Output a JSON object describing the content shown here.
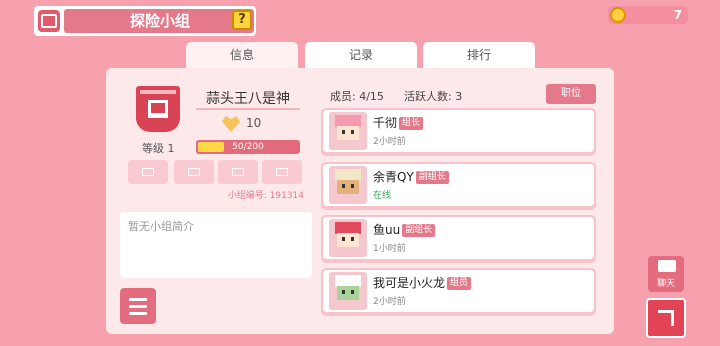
{
  "header": {
    "title": "探险小组",
    "help_label": "?",
    "currency_value": "7"
  },
  "tabs": [
    "信息",
    "记录",
    "排行"
  ],
  "group": {
    "name": "蒜头王八是神",
    "popularity": "10",
    "level_label": "等级 1",
    "exp_text": "50/200",
    "exp_fraction": 0.25,
    "id_label": "小组编号: 191314",
    "intro_text": "暂无小组简介"
  },
  "members_header": {
    "count_text": "成员: 4/15",
    "active_text": "活跃人数: 3",
    "position_button": "职位"
  },
  "members": [
    {
      "name": "千彻",
      "role": "组长",
      "status": "2小时前",
      "online": false
    },
    {
      "name": "余青QY",
      "role": "副组长",
      "status": "在线",
      "online": true
    },
    {
      "name": "鱼uu",
      "role": "副组长",
      "status": "1小时前",
      "online": false
    },
    {
      "name": "我可是小火龙",
      "role": "组员",
      "status": "2小时前",
      "online": false
    }
  ],
  "side": {
    "chat_label": "聊天"
  },
  "colors": {
    "background": "#f7a0ae",
    "accent": "#e3798a",
    "online": "#3aa65a"
  }
}
